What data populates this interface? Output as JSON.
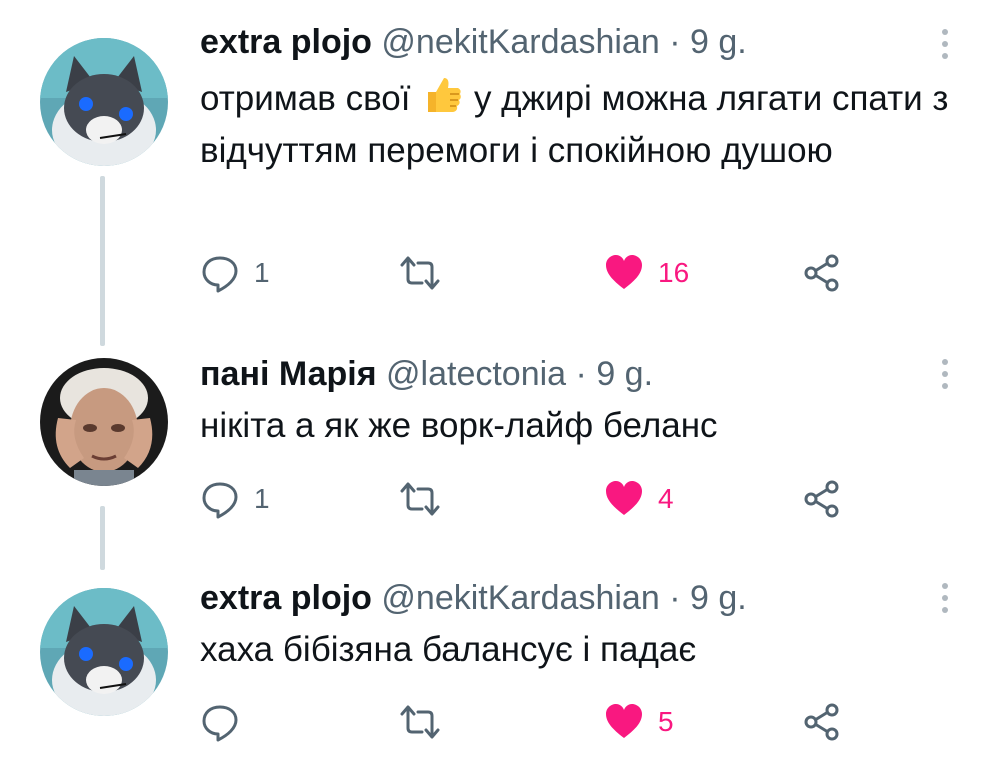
{
  "tweets": [
    {
      "avatar": "cat-avatar",
      "name": "extra plojo",
      "handle": "@nekitKardashian",
      "separator": "·",
      "time": "9 g.",
      "text_parts": [
        "отримав свої",
        "у джирі можна лягати спати з відчуттям перемоги і спокійною душою"
      ],
      "emoji": "thumbs-up",
      "replies": "1",
      "retweets": "",
      "likes": "16"
    },
    {
      "avatar": "old-man-avatar",
      "name": "пані Марія",
      "handle": "@latectonia",
      "separator": "·",
      "time": "9 g.",
      "text": "нікіта а як же ворк-лайф беланс",
      "replies": "1",
      "retweets": "",
      "likes": "4"
    },
    {
      "avatar": "cat-avatar",
      "name": "extra plojo",
      "handle": "@nekitKardashian",
      "separator": "·",
      "time": "9 g.",
      "text": "хаха бібізяна балансує і падає",
      "replies": "",
      "retweets": "",
      "likes": "5"
    }
  ],
  "colors": {
    "like": "#f91880",
    "muted": "#536471",
    "thread_line": "#cfd9de",
    "text": "#0f1419"
  },
  "icons": [
    "reply-icon",
    "retweet-icon",
    "heart-icon",
    "share-icon",
    "more-icon"
  ]
}
